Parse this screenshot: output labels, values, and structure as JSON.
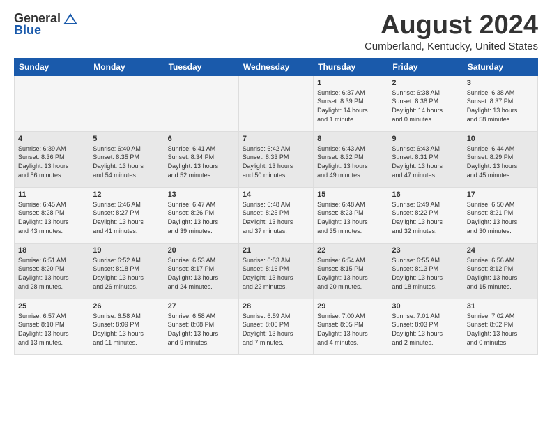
{
  "header": {
    "logo_general": "General",
    "logo_blue": "Blue",
    "month_title": "August 2024",
    "subtitle": "Cumberland, Kentucky, United States"
  },
  "days_of_week": [
    "Sunday",
    "Monday",
    "Tuesday",
    "Wednesday",
    "Thursday",
    "Friday",
    "Saturday"
  ],
  "weeks": [
    [
      {
        "day": "",
        "info": ""
      },
      {
        "day": "",
        "info": ""
      },
      {
        "day": "",
        "info": ""
      },
      {
        "day": "",
        "info": ""
      },
      {
        "day": "1",
        "info": "Sunrise: 6:37 AM\nSunset: 8:39 PM\nDaylight: 14 hours\nand 1 minute."
      },
      {
        "day": "2",
        "info": "Sunrise: 6:38 AM\nSunset: 8:38 PM\nDaylight: 14 hours\nand 0 minutes."
      },
      {
        "day": "3",
        "info": "Sunrise: 6:38 AM\nSunset: 8:37 PM\nDaylight: 13 hours\nand 58 minutes."
      }
    ],
    [
      {
        "day": "4",
        "info": "Sunrise: 6:39 AM\nSunset: 8:36 PM\nDaylight: 13 hours\nand 56 minutes."
      },
      {
        "day": "5",
        "info": "Sunrise: 6:40 AM\nSunset: 8:35 PM\nDaylight: 13 hours\nand 54 minutes."
      },
      {
        "day": "6",
        "info": "Sunrise: 6:41 AM\nSunset: 8:34 PM\nDaylight: 13 hours\nand 52 minutes."
      },
      {
        "day": "7",
        "info": "Sunrise: 6:42 AM\nSunset: 8:33 PM\nDaylight: 13 hours\nand 50 minutes."
      },
      {
        "day": "8",
        "info": "Sunrise: 6:43 AM\nSunset: 8:32 PM\nDaylight: 13 hours\nand 49 minutes."
      },
      {
        "day": "9",
        "info": "Sunrise: 6:43 AM\nSunset: 8:31 PM\nDaylight: 13 hours\nand 47 minutes."
      },
      {
        "day": "10",
        "info": "Sunrise: 6:44 AM\nSunset: 8:29 PM\nDaylight: 13 hours\nand 45 minutes."
      }
    ],
    [
      {
        "day": "11",
        "info": "Sunrise: 6:45 AM\nSunset: 8:28 PM\nDaylight: 13 hours\nand 43 minutes."
      },
      {
        "day": "12",
        "info": "Sunrise: 6:46 AM\nSunset: 8:27 PM\nDaylight: 13 hours\nand 41 minutes."
      },
      {
        "day": "13",
        "info": "Sunrise: 6:47 AM\nSunset: 8:26 PM\nDaylight: 13 hours\nand 39 minutes."
      },
      {
        "day": "14",
        "info": "Sunrise: 6:48 AM\nSunset: 8:25 PM\nDaylight: 13 hours\nand 37 minutes."
      },
      {
        "day": "15",
        "info": "Sunrise: 6:48 AM\nSunset: 8:23 PM\nDaylight: 13 hours\nand 35 minutes."
      },
      {
        "day": "16",
        "info": "Sunrise: 6:49 AM\nSunset: 8:22 PM\nDaylight: 13 hours\nand 32 minutes."
      },
      {
        "day": "17",
        "info": "Sunrise: 6:50 AM\nSunset: 8:21 PM\nDaylight: 13 hours\nand 30 minutes."
      }
    ],
    [
      {
        "day": "18",
        "info": "Sunrise: 6:51 AM\nSunset: 8:20 PM\nDaylight: 13 hours\nand 28 minutes."
      },
      {
        "day": "19",
        "info": "Sunrise: 6:52 AM\nSunset: 8:18 PM\nDaylight: 13 hours\nand 26 minutes."
      },
      {
        "day": "20",
        "info": "Sunrise: 6:53 AM\nSunset: 8:17 PM\nDaylight: 13 hours\nand 24 minutes."
      },
      {
        "day": "21",
        "info": "Sunrise: 6:53 AM\nSunset: 8:16 PM\nDaylight: 13 hours\nand 22 minutes."
      },
      {
        "day": "22",
        "info": "Sunrise: 6:54 AM\nSunset: 8:15 PM\nDaylight: 13 hours\nand 20 minutes."
      },
      {
        "day": "23",
        "info": "Sunrise: 6:55 AM\nSunset: 8:13 PM\nDaylight: 13 hours\nand 18 minutes."
      },
      {
        "day": "24",
        "info": "Sunrise: 6:56 AM\nSunset: 8:12 PM\nDaylight: 13 hours\nand 15 minutes."
      }
    ],
    [
      {
        "day": "25",
        "info": "Sunrise: 6:57 AM\nSunset: 8:10 PM\nDaylight: 13 hours\nand 13 minutes."
      },
      {
        "day": "26",
        "info": "Sunrise: 6:58 AM\nSunset: 8:09 PM\nDaylight: 13 hours\nand 11 minutes."
      },
      {
        "day": "27",
        "info": "Sunrise: 6:58 AM\nSunset: 8:08 PM\nDaylight: 13 hours\nand 9 minutes."
      },
      {
        "day": "28",
        "info": "Sunrise: 6:59 AM\nSunset: 8:06 PM\nDaylight: 13 hours\nand 7 minutes."
      },
      {
        "day": "29",
        "info": "Sunrise: 7:00 AM\nSunset: 8:05 PM\nDaylight: 13 hours\nand 4 minutes."
      },
      {
        "day": "30",
        "info": "Sunrise: 7:01 AM\nSunset: 8:03 PM\nDaylight: 13 hours\nand 2 minutes."
      },
      {
        "day": "31",
        "info": "Sunrise: 7:02 AM\nSunset: 8:02 PM\nDaylight: 13 hours\nand 0 minutes."
      }
    ]
  ]
}
